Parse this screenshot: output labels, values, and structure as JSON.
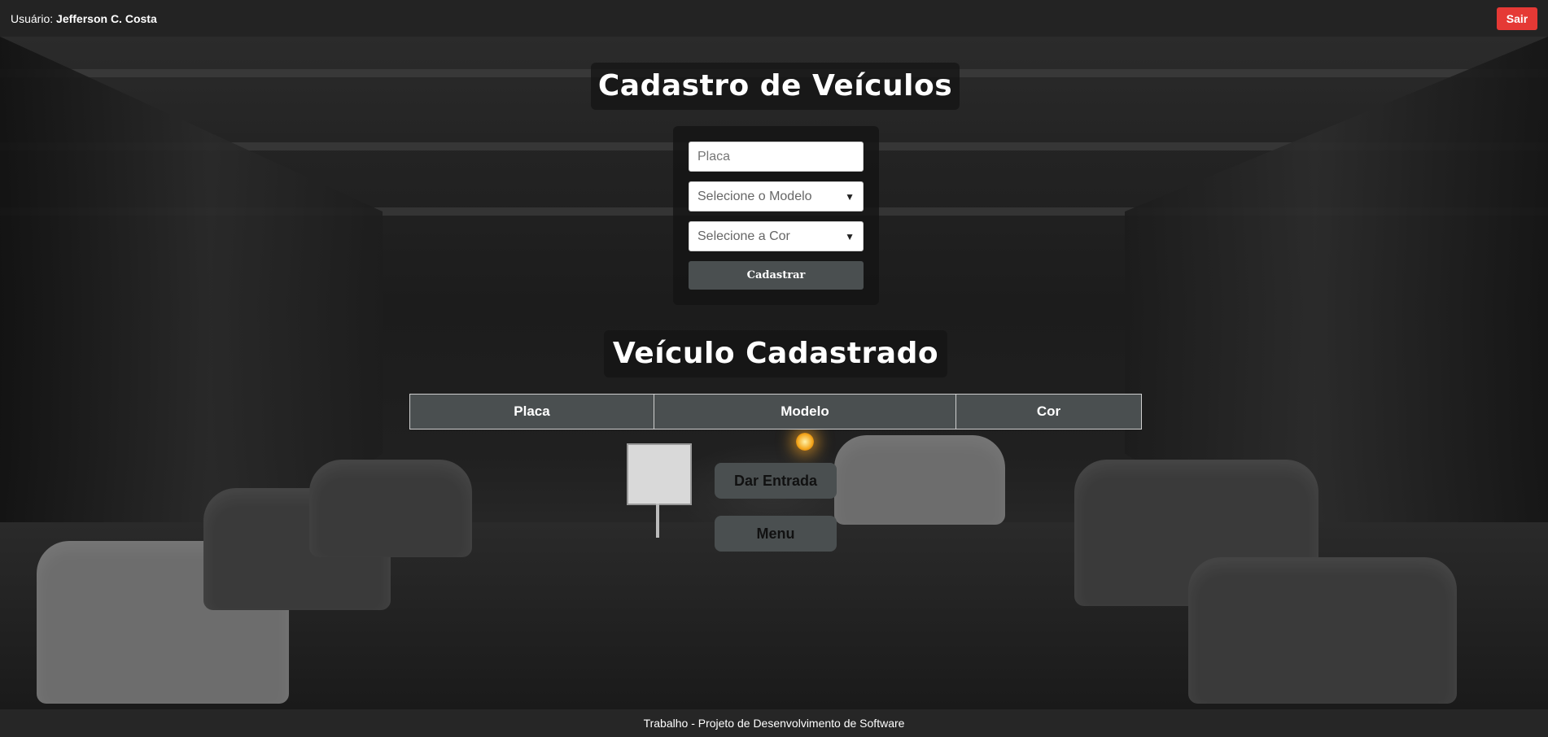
{
  "topbar": {
    "user_prefix": "Usuário:",
    "user_name": "Jefferson C. Costa",
    "logout_label": "Sair"
  },
  "form": {
    "title": "Cadastro de Veículos",
    "placa_placeholder": "Placa",
    "modelo_selected": "Selecione o Modelo",
    "cor_selected": "Selecione a Cor",
    "submit_label": "Cadastrar"
  },
  "table": {
    "title": "Veículo Cadastrado",
    "headers": [
      "Placa",
      "Modelo",
      "Cor"
    ]
  },
  "actions": {
    "entrada_label": "Dar Entrada",
    "menu_label": "Menu"
  },
  "footer": {
    "text": "Trabalho - Projeto de Desenvolvimento de Software"
  },
  "colors": {
    "logout": "#e53935",
    "panel": "#4a4f50",
    "bar": "#232323"
  }
}
